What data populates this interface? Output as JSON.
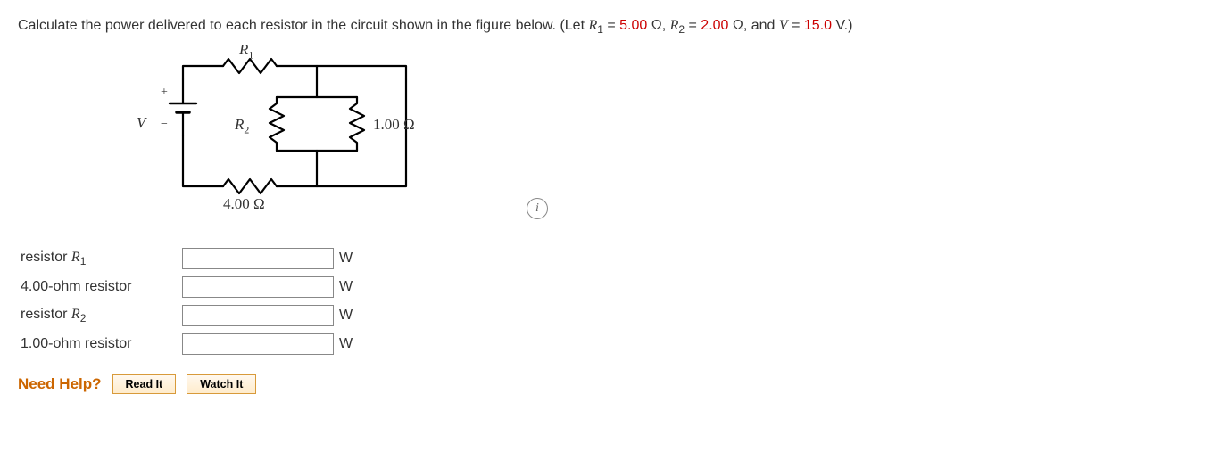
{
  "problem": {
    "prefix": "Calculate the power delivered to each resistor in the circuit shown in the figure below. (Let ",
    "r1_sym": "R",
    "r1_sub": "1",
    "eq": " = ",
    "r1_val": "5.00",
    "omega": " Ω, ",
    "r2_sym": "R",
    "r2_sub": "2",
    "r2_val": "2.00",
    "omega2": " Ω, and ",
    "v_sym": "V",
    "v_val": "15.0",
    "v_unit": " V.)"
  },
  "circuit": {
    "R1": "R",
    "R1sub": "1",
    "R2": "R",
    "R2sub": "2",
    "V": "V",
    "plus": "+",
    "minus": "−",
    "r_right": "1.00 Ω",
    "r_bottom": "4.00 Ω"
  },
  "answers": {
    "rows": [
      {
        "label_pre": "resistor ",
        "label_sym": "R",
        "label_sub": "1",
        "label_post": ""
      },
      {
        "label_pre": "4.00-ohm resistor",
        "label_sym": "",
        "label_sub": "",
        "label_post": ""
      },
      {
        "label_pre": "resistor ",
        "label_sym": "R",
        "label_sub": "2",
        "label_post": ""
      },
      {
        "label_pre": "1.00-ohm resistor",
        "label_sym": "",
        "label_sub": "",
        "label_post": ""
      }
    ],
    "unit": "W"
  },
  "help": {
    "label": "Need Help?",
    "read": "Read It",
    "watch": "Watch It"
  },
  "info_glyph": "i"
}
